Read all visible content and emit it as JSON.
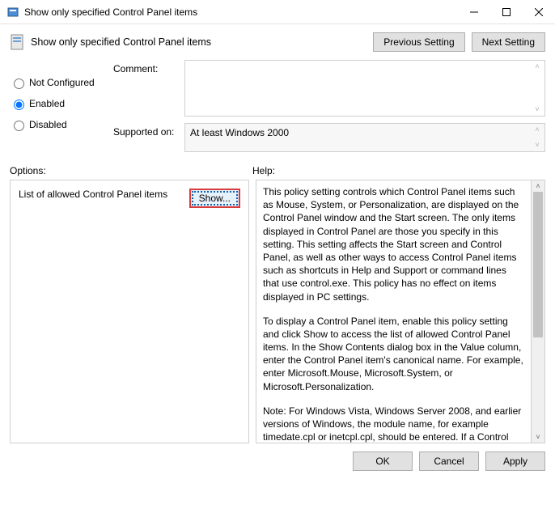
{
  "window": {
    "title": "Show only specified Control Panel items",
    "minimize": "—",
    "maximize": "☐",
    "close": "✕"
  },
  "header": {
    "title": "Show only specified Control Panel items",
    "prev": "Previous Setting",
    "next": "Next Setting"
  },
  "radios": {
    "not_configured": "Not Configured",
    "enabled": "Enabled",
    "disabled": "Disabled",
    "selected": "enabled"
  },
  "fields": {
    "comment_label": "Comment:",
    "supported_label": "Supported on:",
    "supported_value": "At least Windows 2000"
  },
  "labels": {
    "options": "Options:",
    "help": "Help:"
  },
  "options": {
    "list_label": "List of allowed Control Panel items",
    "show_button": "Show..."
  },
  "help": {
    "p1": "This policy setting controls which Control Panel items such as Mouse, System, or Personalization, are displayed on the Control Panel window and the Start screen. The only items displayed in Control Panel are those you specify in this setting. This setting affects the Start screen and Control Panel, as well as other ways to access Control Panel items such as shortcuts in Help and Support or command lines that use control.exe. This policy has no effect on items displayed in PC settings.",
    "p2": "To display a Control Panel item, enable this policy setting and click Show to access the list of allowed Control Panel items. In the Show Contents dialog box in the Value column, enter the Control Panel item's canonical name. For example, enter Microsoft.Mouse, Microsoft.System, or Microsoft.Personalization.",
    "p3": "Note: For Windows Vista, Windows Server 2008, and earlier versions of Windows, the module name, for example timedate.cpl or inetcpl.cpl, should be entered. If a Control Panel item does not have a CPL file, or the CPL file contains multiple applets, then its module name and string resource identification"
  },
  "footer": {
    "ok": "OK",
    "cancel": "Cancel",
    "apply": "Apply"
  }
}
